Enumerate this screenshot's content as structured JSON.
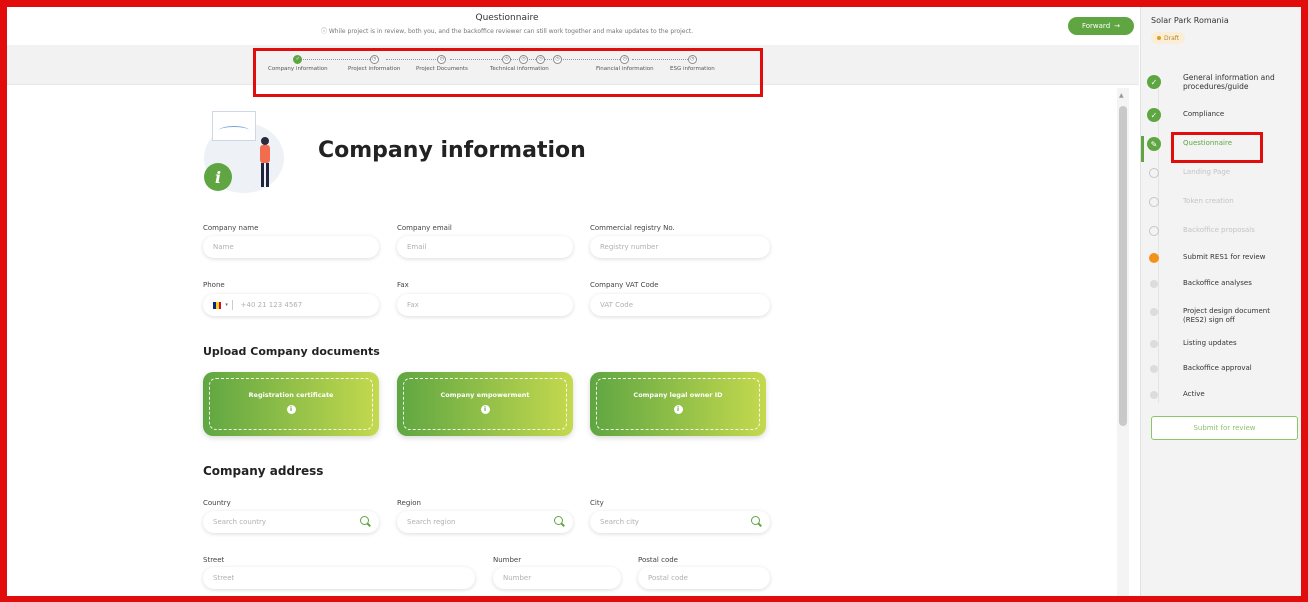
{
  "header": {
    "title": "Questionnaire",
    "note": "While project is in review, both you, and the backoffice reviewer can still work together and make updates to the project.",
    "forward_label": "Forward"
  },
  "steps": [
    {
      "label": "Company information",
      "state": "done"
    },
    {
      "label": "Project information",
      "state": "todo"
    },
    {
      "label": "Project Documents",
      "state": "todo"
    },
    {
      "label": "Technical information",
      "state": "todo"
    },
    {
      "label": "Financial information",
      "state": "todo"
    },
    {
      "label": "ESG information",
      "state": "todo"
    }
  ],
  "form": {
    "title": "Company information",
    "company_name": {
      "label": "Company name",
      "placeholder": "Name"
    },
    "company_email": {
      "label": "Company email",
      "placeholder": "Email"
    },
    "registry": {
      "label": "Commercial registry No.",
      "placeholder": "Registry number"
    },
    "phone": {
      "label": "Phone",
      "placeholder": "+40 21 123 4567"
    },
    "fax": {
      "label": "Fax",
      "placeholder": "Fax"
    },
    "vat": {
      "label": "Company VAT Code",
      "placeholder": "VAT Code"
    },
    "upload_heading": "Upload Company documents",
    "uploads": [
      {
        "label": "Registration certificate"
      },
      {
        "label": "Company empowerment"
      },
      {
        "label": "Company legal owner ID"
      }
    ],
    "address_heading": "Company address",
    "country": {
      "label": "Country",
      "placeholder": "Search country"
    },
    "region": {
      "label": "Region",
      "placeholder": "Search region"
    },
    "city": {
      "label": "City",
      "placeholder": "Search city"
    },
    "street": {
      "label": "Street",
      "placeholder": "Street"
    },
    "number": {
      "label": "Number",
      "placeholder": "Number"
    },
    "postal": {
      "label": "Postal code",
      "placeholder": "Postal code"
    }
  },
  "sidebar": {
    "project_name": "Solar Park Romania",
    "status": "Draft",
    "items": [
      {
        "label": "General information and procedures/guide",
        "state": "done"
      },
      {
        "label": "Compliance",
        "state": "done"
      },
      {
        "label": "Questionnaire",
        "state": "current"
      },
      {
        "label": "Landing Page",
        "state": "pending"
      },
      {
        "label": "Token creation",
        "state": "pending"
      },
      {
        "label": "Backoffice proposals",
        "state": "pending"
      },
      {
        "label": "Submit RES1 for review",
        "state": "next"
      },
      {
        "label": "Backoffice analyses",
        "state": "future"
      },
      {
        "label": "Project design document (RES2) sign off",
        "state": "future"
      },
      {
        "label": "Listing updates",
        "state": "future"
      },
      {
        "label": "Backoffice approval",
        "state": "future"
      },
      {
        "label": "Active",
        "state": "future"
      }
    ],
    "submit_label": "Submit for review"
  },
  "colors": {
    "accent": "#5fa642",
    "highlight_frame": "#e10c0c",
    "next_step": "#f2911b"
  }
}
